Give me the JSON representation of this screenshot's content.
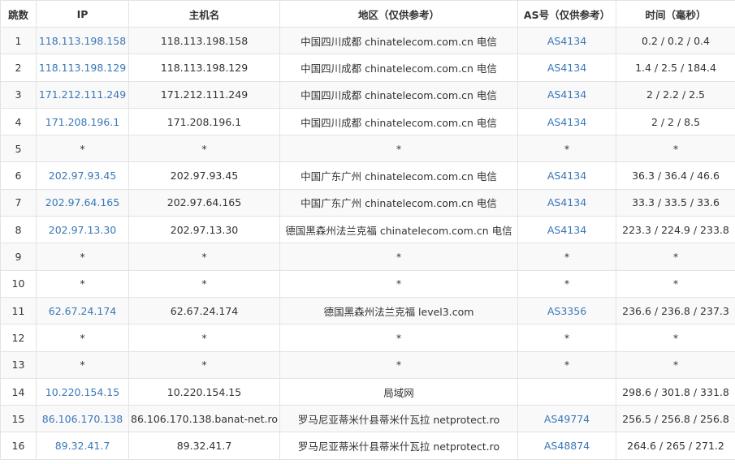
{
  "headers": [
    "跳数",
    "IP",
    "主机名",
    "地区（仅供参考）",
    "AS号（仅供参考）",
    "时间（毫秒）"
  ],
  "rows": [
    {
      "hop": "1",
      "ip": "118.113.198.158",
      "host": "118.113.198.158",
      "region": "中国四川成都 chinatelecom.com.cn 电信",
      "asn": "AS4134",
      "time": "0.2 / 0.2 / 0.4"
    },
    {
      "hop": "2",
      "ip": "118.113.198.129",
      "host": "118.113.198.129",
      "region": "中国四川成都 chinatelecom.com.cn 电信",
      "asn": "AS4134",
      "time": "1.4 / 2.5 / 184.4"
    },
    {
      "hop": "3",
      "ip": "171.212.111.249",
      "host": "171.212.111.249",
      "region": "中国四川成都 chinatelecom.com.cn 电信",
      "asn": "AS4134",
      "time": "2 / 2.2 / 2.5"
    },
    {
      "hop": "4",
      "ip": "171.208.196.1",
      "host": "171.208.196.1",
      "region": "中国四川成都 chinatelecom.com.cn 电信",
      "asn": "AS4134",
      "time": "2 / 2 / 8.5"
    },
    {
      "hop": "5",
      "ip": "*",
      "host": "*",
      "region": "*",
      "asn": "*",
      "time": "*"
    },
    {
      "hop": "6",
      "ip": "202.97.93.45",
      "host": "202.97.93.45",
      "region": "中国广东广州 chinatelecom.com.cn 电信",
      "asn": "AS4134",
      "time": "36.3 / 36.4 / 46.6"
    },
    {
      "hop": "7",
      "ip": "202.97.64.165",
      "host": "202.97.64.165",
      "region": "中国广东广州 chinatelecom.com.cn 电信",
      "asn": "AS4134",
      "time": "33.3 / 33.5 / 33.6"
    },
    {
      "hop": "8",
      "ip": "202.97.13.30",
      "host": "202.97.13.30",
      "region": "德国黑森州法兰克福 chinatelecom.com.cn 电信",
      "asn": "AS4134",
      "time": "223.3 / 224.9 / 233.8"
    },
    {
      "hop": "9",
      "ip": "*",
      "host": "*",
      "region": "*",
      "asn": "*",
      "time": "*"
    },
    {
      "hop": "10",
      "ip": "*",
      "host": "*",
      "region": "*",
      "asn": "*",
      "time": "*"
    },
    {
      "hop": "11",
      "ip": "62.67.24.174",
      "host": "62.67.24.174",
      "region": "德国黑森州法兰克福 level3.com",
      "asn": "AS3356",
      "time": "236.6 / 236.8 / 237.3"
    },
    {
      "hop": "12",
      "ip": "*",
      "host": "*",
      "region": "*",
      "asn": "*",
      "time": "*"
    },
    {
      "hop": "13",
      "ip": "*",
      "host": "*",
      "region": "*",
      "asn": "*",
      "time": "*"
    },
    {
      "hop": "14",
      "ip": "10.220.154.15",
      "host": "10.220.154.15",
      "region": "局域网",
      "asn": "",
      "time": "298.6 / 301.8 / 331.8"
    },
    {
      "hop": "15",
      "ip": "86.106.170.138",
      "host": "86.106.170.138.banat-net.ro",
      "region": "罗马尼亚蒂米什县蒂米什瓦拉 netprotect.ro",
      "asn": "AS49774",
      "time": "256.5 / 256.8 / 256.8"
    },
    {
      "hop": "16",
      "ip": "89.32.41.7",
      "host": "89.32.41.7",
      "region": "罗马尼亚蒂米什县蒂米什瓦拉 netprotect.ro",
      "asn": "AS48874",
      "time": "264.6 / 265 / 271.2"
    }
  ],
  "colors": {
    "link": "#3a77b8",
    "text": "#333333",
    "stripe": "#f9f9f9",
    "border": "#e3e3e3"
  }
}
